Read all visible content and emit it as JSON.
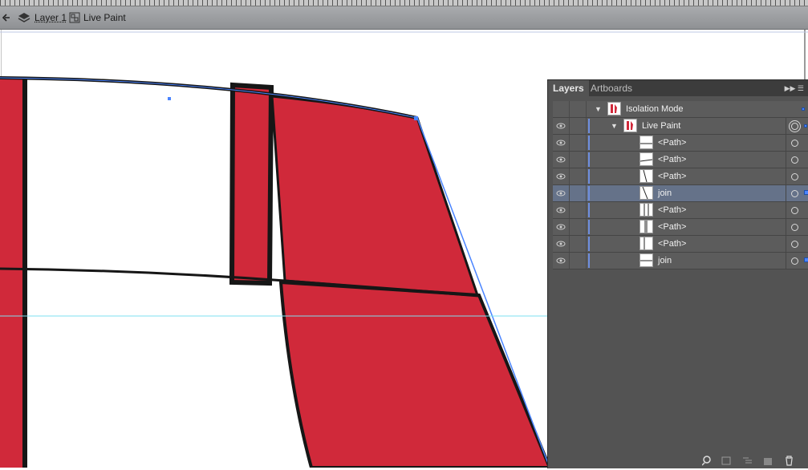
{
  "breadcrumb": {
    "layer": "Layer 1",
    "group": "Live Paint"
  },
  "layers_panel": {
    "tabs": [
      "Layers",
      "Artboards"
    ],
    "rows": [
      {
        "name": "Isolation Mode",
        "level": 0,
        "expanded": true,
        "selected": false,
        "thumb": "red-shape"
      },
      {
        "name": "Live Paint",
        "level": 1,
        "expanded": true,
        "selected": false,
        "thumb": "red-shape"
      },
      {
        "name": "<Path>",
        "level": 2,
        "selected": false
      },
      {
        "name": "<Path>",
        "level": 2,
        "selected": false
      },
      {
        "name": "<Path>",
        "level": 2,
        "selected": false
      },
      {
        "name": "join",
        "level": 2,
        "selected": true
      },
      {
        "name": "<Path>",
        "level": 2,
        "selected": false
      },
      {
        "name": "<Path>",
        "level": 2,
        "selected": false
      },
      {
        "name": "<Path>",
        "level": 2,
        "selected": false
      },
      {
        "name": "join",
        "level": 2,
        "selected": false
      }
    ]
  },
  "colors": {
    "fill_red": "#d0293a",
    "stroke": "#161616",
    "guide": "#7fe0f0",
    "selection": "#4a84ff"
  }
}
